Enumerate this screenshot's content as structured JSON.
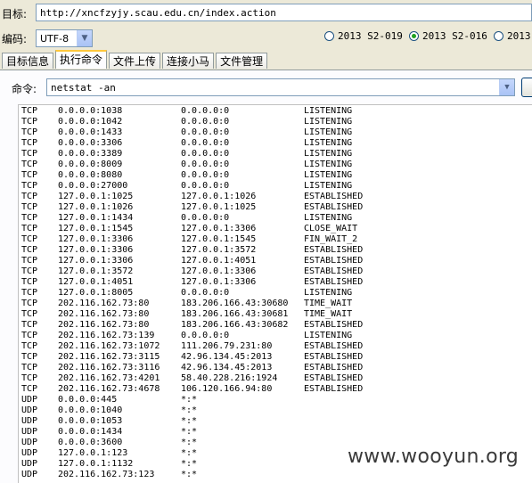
{
  "target": {
    "label": "目标:",
    "url": "http://xncfzyjy.scau.edu.cn/index.action"
  },
  "encoding": {
    "label": "编码:",
    "value": "UTF-8"
  },
  "radios": [
    {
      "label": "2013 S2-019",
      "checked": false
    },
    {
      "label": "2013 S2-016",
      "checked": true
    },
    {
      "label": "2013",
      "checked": false
    }
  ],
  "tabs": [
    {
      "label": "目标信息",
      "active": false
    },
    {
      "label": "执行命令",
      "active": true
    },
    {
      "label": "文件上传",
      "active": false
    },
    {
      "label": "连接小马",
      "active": false
    },
    {
      "label": "文件管理",
      "active": false
    }
  ],
  "command": {
    "label": "命令:",
    "value": "netstat -an"
  },
  "output": [
    [
      "TCP",
      "0.0.0.0:1038",
      "0.0.0.0:0",
      "LISTENING"
    ],
    [
      "TCP",
      "0.0.0.0:1042",
      "0.0.0.0:0",
      "LISTENING"
    ],
    [
      "TCP",
      "0.0.0.0:1433",
      "0.0.0.0:0",
      "LISTENING"
    ],
    [
      "TCP",
      "0.0.0.0:3306",
      "0.0.0.0:0",
      "LISTENING"
    ],
    [
      "TCP",
      "0.0.0.0:3389",
      "0.0.0.0:0",
      "LISTENING"
    ],
    [
      "TCP",
      "0.0.0.0:8009",
      "0.0.0.0:0",
      "LISTENING"
    ],
    [
      "TCP",
      "0.0.0.0:8080",
      "0.0.0.0:0",
      "LISTENING"
    ],
    [
      "TCP",
      "0.0.0.0:27000",
      "0.0.0.0:0",
      "LISTENING"
    ],
    [
      "TCP",
      "127.0.0.1:1025",
      "127.0.0.1:1026",
      "ESTABLISHED"
    ],
    [
      "TCP",
      "127.0.0.1:1026",
      "127.0.0.1:1025",
      "ESTABLISHED"
    ],
    [
      "TCP",
      "127.0.0.1:1434",
      "0.0.0.0:0",
      "LISTENING"
    ],
    [
      "TCP",
      "127.0.0.1:1545",
      "127.0.0.1:3306",
      "CLOSE_WAIT"
    ],
    [
      "TCP",
      "127.0.0.1:3306",
      "127.0.0.1:1545",
      "FIN_WAIT_2"
    ],
    [
      "TCP",
      "127.0.0.1:3306",
      "127.0.0.1:3572",
      "ESTABLISHED"
    ],
    [
      "TCP",
      "127.0.0.1:3306",
      "127.0.0.1:4051",
      "ESTABLISHED"
    ],
    [
      "TCP",
      "127.0.0.1:3572",
      "127.0.0.1:3306",
      "ESTABLISHED"
    ],
    [
      "TCP",
      "127.0.0.1:4051",
      "127.0.0.1:3306",
      "ESTABLISHED"
    ],
    [
      "TCP",
      "127.0.0.1:8005",
      "0.0.0.0:0",
      "LISTENING"
    ],
    [
      "TCP",
      "202.116.162.73:80",
      "183.206.166.43:30680",
      "TIME_WAIT"
    ],
    [
      "TCP",
      "202.116.162.73:80",
      "183.206.166.43:30681",
      "TIME_WAIT"
    ],
    [
      "TCP",
      "202.116.162.73:80",
      "183.206.166.43:30682",
      "ESTABLISHED"
    ],
    [
      "TCP",
      "202.116.162.73:139",
      "0.0.0.0:0",
      "LISTENING"
    ],
    [
      "TCP",
      "202.116.162.73:1072",
      "111.206.79.231:80",
      "ESTABLISHED"
    ],
    [
      "TCP",
      "202.116.162.73:3115",
      "42.96.134.45:2013",
      "ESTABLISHED"
    ],
    [
      "TCP",
      "202.116.162.73:3116",
      "42.96.134.45:2013",
      "ESTABLISHED"
    ],
    [
      "TCP",
      "202.116.162.73:4201",
      "58.40.228.216:1924",
      "ESTABLISHED"
    ],
    [
      "TCP",
      "202.116.162.73:4678",
      "106.120.166.94:80",
      "ESTABLISHED"
    ],
    [
      "UDP",
      "0.0.0.0:445",
      "*:*",
      ""
    ],
    [
      "UDP",
      "0.0.0.0:1040",
      "*:*",
      ""
    ],
    [
      "UDP",
      "0.0.0.0:1053",
      "*:*",
      ""
    ],
    [
      "UDP",
      "0.0.0.0:1434",
      "*:*",
      ""
    ],
    [
      "UDP",
      "0.0.0.0:3600",
      "*:*",
      ""
    ],
    [
      "UDP",
      "127.0.0.1:123",
      "*:*",
      ""
    ],
    [
      "UDP",
      "127.0.0.1:1132",
      "*:*",
      ""
    ],
    [
      "UDP",
      "202.116.162.73:123",
      "*:*",
      ""
    ]
  ],
  "watermark": "www.wooyun.org"
}
